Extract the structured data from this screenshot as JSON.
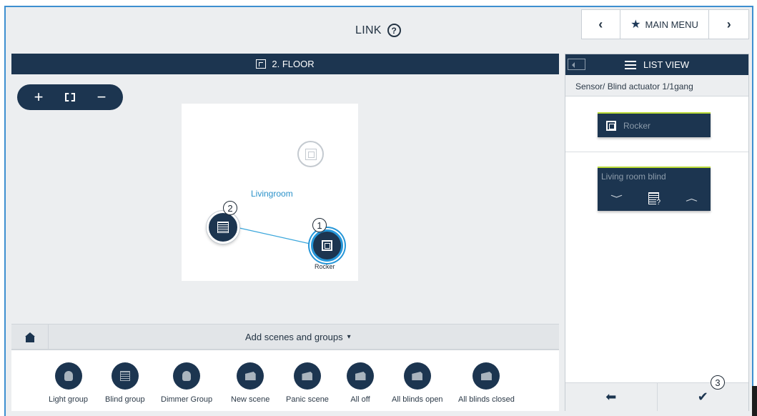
{
  "header": {
    "title": "LINK",
    "help_icon": "question-circle-icon",
    "nav": {
      "prev": "‹",
      "main_menu": "MAIN MENU",
      "next": "›"
    }
  },
  "floor": {
    "title": "2. FLOOR",
    "room_label": "Livingroom",
    "devices": [
      {
        "label": "Rocker",
        "marker": "1"
      },
      {
        "marker": "2"
      }
    ],
    "zoom": {
      "in": "+",
      "out": "−"
    }
  },
  "scenes_bar": {
    "label": "Add scenes and groups"
  },
  "tray": [
    {
      "label": "Light group",
      "icon": "bulb-icon"
    },
    {
      "label": "Blind group",
      "icon": "blind-icon"
    },
    {
      "label": "Dimmer Group",
      "icon": "bulb-icon"
    },
    {
      "label": "New scene",
      "icon": "clapper-icon"
    },
    {
      "label": "Panic scene",
      "icon": "clapper-icon"
    },
    {
      "label": "All off",
      "icon": "clapper-icon"
    },
    {
      "label": "All blinds open",
      "icon": "clapper-icon"
    },
    {
      "label": "All blinds closed",
      "icon": "clapper-icon"
    }
  ],
  "right_panel": {
    "title": "LIST VIEW",
    "subtitle": "Sensor/ Blind actuator 1/1gang",
    "card_rocker": "Rocker",
    "card_blind": "Living room blind",
    "marker": "3"
  },
  "colors": {
    "navy": "#1c3550",
    "accent_blue": "#2596d8",
    "accent_green": "#b8d936"
  }
}
